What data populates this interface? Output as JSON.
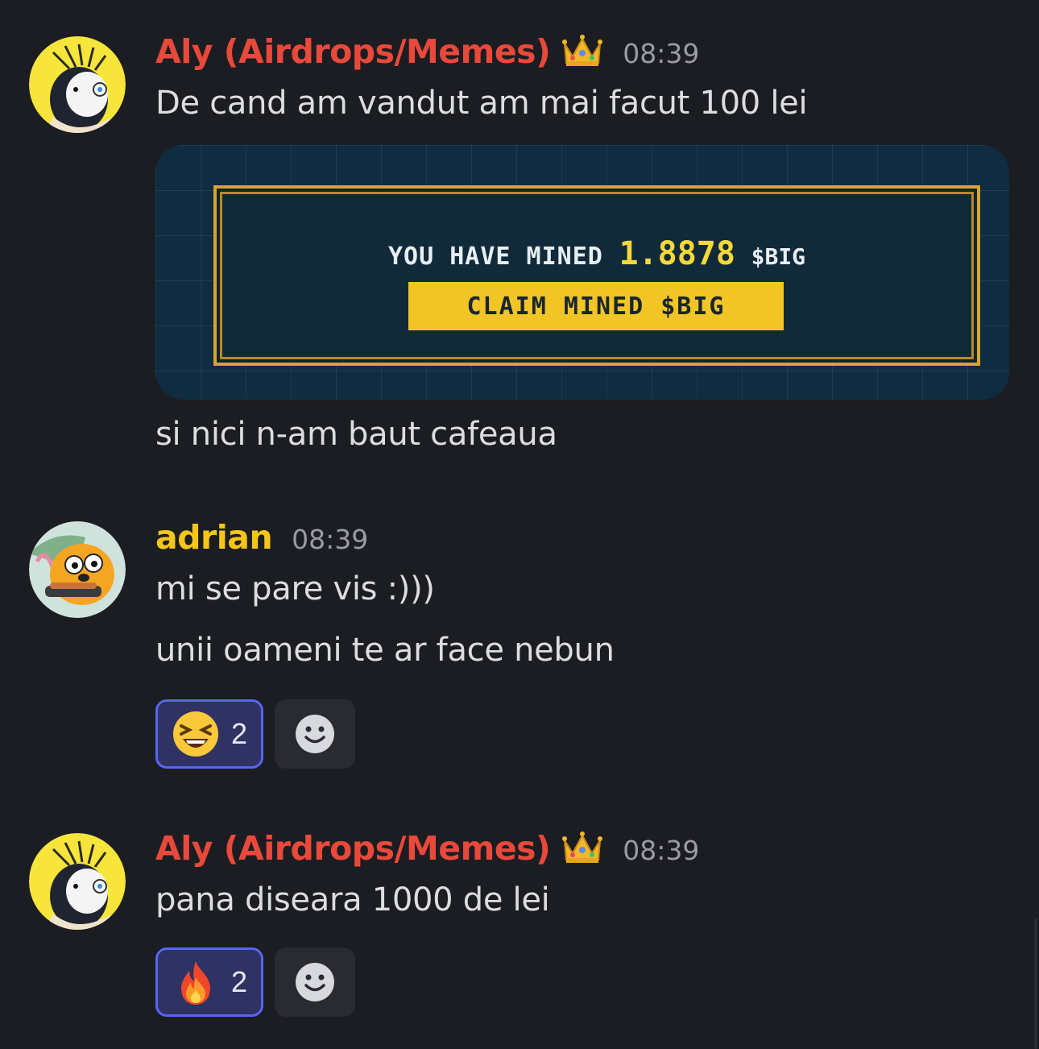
{
  "messages": [
    {
      "author": "Aly (Airdrops/Memes)",
      "time": "08:39",
      "lines": [
        "De cand am vandut am mai facut 100 lei",
        "si nici n-am baut cafeaua"
      ],
      "embed": {
        "mined_label": "YOU HAVE MINED",
        "mined_value": "1.8878",
        "mined_unit": "$BIG",
        "button_label": "CLAIM MINED $BIG"
      }
    },
    {
      "author": "adrian",
      "time": "08:39",
      "lines": [
        "mi se pare vis :)))",
        "unii oameni te ar face nebun"
      ],
      "reaction": {
        "emoji": "laughing-emoji",
        "count": "2"
      }
    },
    {
      "author": "Aly (Airdrops/Memes)",
      "time": "08:39",
      "lines": [
        "pana diseara 1000 de lei"
      ],
      "reaction": {
        "emoji": "fire-emoji",
        "count": "2"
      }
    }
  ],
  "colors": {
    "background": "#1c1d22",
    "aly_name": "#e8493b",
    "adrian_name": "#f5c619",
    "reaction_active_border": "#5865f2"
  }
}
